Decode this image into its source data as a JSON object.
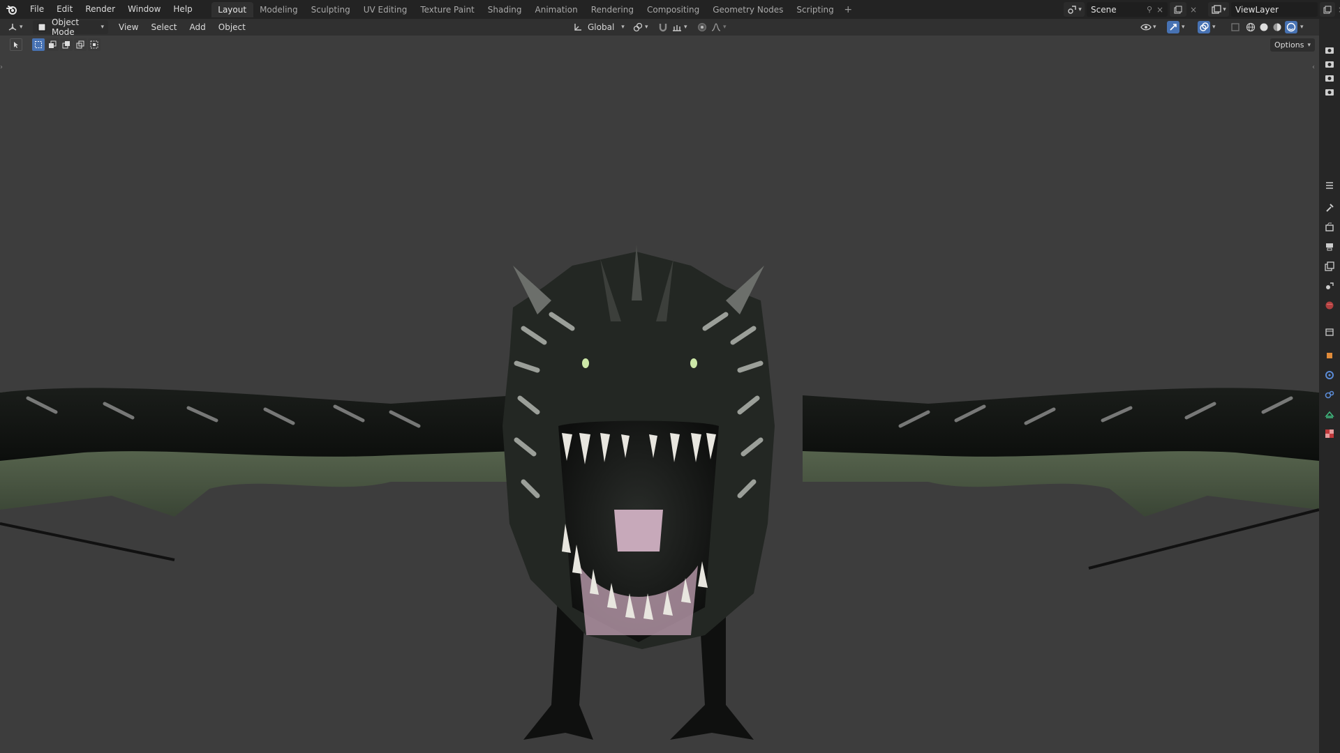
{
  "topbar": {
    "menus": [
      "File",
      "Edit",
      "Render",
      "Window",
      "Help"
    ],
    "workspace_tabs": [
      "Layout",
      "Modeling",
      "Sculpting",
      "UV Editing",
      "Texture Paint",
      "Shading",
      "Animation",
      "Rendering",
      "Compositing",
      "Geometry Nodes",
      "Scripting"
    ],
    "active_tab": "Layout",
    "add_tab": "+",
    "scene_name": "Scene",
    "view_layer_name": "ViewLayer"
  },
  "header": {
    "mode": "Object Mode",
    "menus": [
      "View",
      "Select",
      "Add",
      "Object"
    ],
    "transform_orientation": "Global"
  },
  "viewport": {
    "options_label": "Options",
    "background_color": "#3d3d3d"
  },
  "colors": {
    "accent": "#4772b3",
    "topbar_bg": "#232323",
    "header_bg": "#303030"
  }
}
